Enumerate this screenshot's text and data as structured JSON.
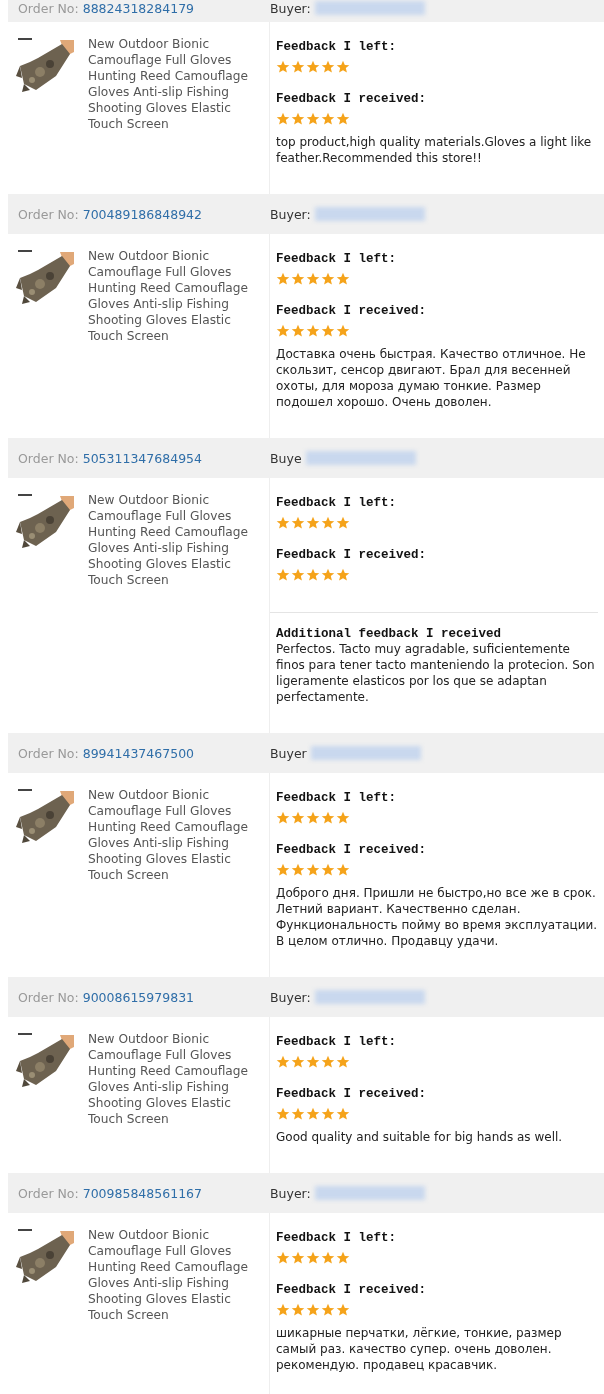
{
  "orders": [
    {
      "order_label": "Order No:",
      "order_no": "88824318284179",
      "buyer_label": "Buyer:",
      "product": "New Outdoor Bionic Camouflage Full Gloves Hunting Reed Camouflage Gloves Anti-slip Fishing Shooting Gloves Elastic Touch Screen",
      "left": {
        "label": "Feedback I left:",
        "stars": 5
      },
      "received": {
        "label": "Feedback I received:",
        "stars": 5
      },
      "comment": "top product,high quality materials.Gloves a light like feather.Recommended this store!!"
    },
    {
      "order_label": "Order No:",
      "order_no": "700489186848942",
      "buyer_label": "Buyer:",
      "product": "New Outdoor Bionic Camouflage Full Gloves Hunting Reed Camouflage Gloves Anti-slip Fishing Shooting Gloves Elastic Touch Screen",
      "left": {
        "label": "Feedback I left:",
        "stars": 5
      },
      "received": {
        "label": "Feedback I received:",
        "stars": 5
      },
      "comment": "Доставка очень быстрая. Качество отличное. Не скользит, сенсор двигают. Брал для весенней охоты, для мороза думаю тонкие. Размер подошел хорошо. Очень доволен."
    },
    {
      "order_label": "Order No:",
      "order_no": "505311347684954",
      "buyer_label": "Buye",
      "product": "New Outdoor Bionic Camouflage Full Gloves Hunting Reed Camouflage Gloves Anti-slip Fishing Shooting Gloves Elastic Touch Screen",
      "left": {
        "label": "Feedback I left:",
        "stars": 5
      },
      "received": {
        "label": "Feedback I received:",
        "stars": 5
      },
      "additional_label": "Additional feedback I received",
      "additional": "Perfectos. Tacto muy agradable, suficientemente finos para tener tacto manteniendo la protecion. Son ligeramente elasticos por los que se adaptan perfectamente."
    },
    {
      "order_label": "Order No:",
      "order_no": "89941437467500",
      "buyer_label": "Buyer",
      "product": "New Outdoor Bionic Camouflage Full Gloves Hunting Reed Camouflage Gloves Anti-slip Fishing Shooting Gloves Elastic Touch Screen",
      "left": {
        "label": "Feedback I left:",
        "stars": 5
      },
      "received": {
        "label": "Feedback I received:",
        "stars": 5
      },
      "comment": "Доброго дня. Пришли не быстро,но все же в срок. Летний вариант. Качественно сделан. Функциональность пойму во время эксплуатации. В целом отлично. Продавцу удачи."
    },
    {
      "order_label": "Order No:",
      "order_no": "90008615979831",
      "buyer_label": "Buyer:",
      "product": "New Outdoor Bionic Camouflage Full Gloves Hunting Reed Camouflage Gloves Anti-slip Fishing Shooting Gloves Elastic Touch Screen",
      "left": {
        "label": "Feedback I left:",
        "stars": 5
      },
      "received": {
        "label": "Feedback I received:",
        "stars": 5
      },
      "comment": "Good quality and suitable for big hands as well."
    },
    {
      "order_label": "Order No:",
      "order_no": "700985848561167",
      "buyer_label": "Buyer:",
      "product": "New Outdoor Bionic Camouflage Full Gloves Hunting Reed Camouflage Gloves Anti-slip Fishing Shooting Gloves Elastic Touch Screen",
      "left": {
        "label": "Feedback I left:",
        "stars": 5
      },
      "received": {
        "label": "Feedback I received:",
        "stars": 5
      },
      "comment": "шикарные перчатки, лёгкие, тонкие, размер самый раз. качество супер. очень доволен. рекомендую. продавец красавчик."
    }
  ]
}
